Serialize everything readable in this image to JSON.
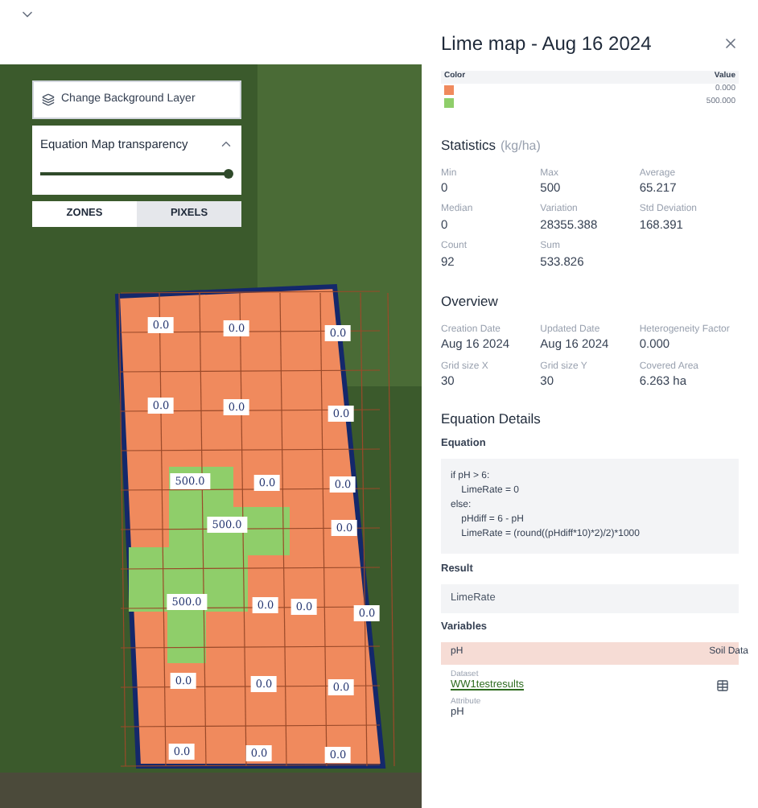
{
  "map": {
    "background_button": {
      "label": "Change Background Layer"
    },
    "transparency": {
      "label": "Equation Map transparency",
      "expanded": true,
      "level": 1
    },
    "view_tabs": [
      {
        "label": "ZONES",
        "selected": false
      },
      {
        "label": "PIXELS",
        "selected": true
      }
    ],
    "labels": [
      {
        "text": "0.0"
      },
      {
        "text": "0.0"
      },
      {
        "text": "0.0"
      },
      {
        "text": "0.0"
      },
      {
        "text": "0.0"
      },
      {
        "text": "0.0"
      },
      {
        "text": "500.0"
      },
      {
        "text": "0.0"
      },
      {
        "text": "0.0"
      },
      {
        "text": "500.0"
      },
      {
        "text": "0.0"
      },
      {
        "text": "500.0"
      },
      {
        "text": "0.0"
      },
      {
        "text": "0.0"
      },
      {
        "text": "0.0"
      },
      {
        "text": "0.0"
      },
      {
        "text": "0.0"
      },
      {
        "text": "0.0"
      },
      {
        "text": "0.0"
      },
      {
        "text": "0.0"
      },
      {
        "text": "0.0"
      }
    ]
  },
  "panel": {
    "title": "Lime map - Aug 16 2024",
    "legend": {
      "columns": [
        "Color",
        "Value"
      ],
      "rows": [
        {
          "color": "#f08a5d",
          "value": "0.000"
        },
        {
          "color": "#8fce6a",
          "value": "500.000"
        }
      ]
    },
    "statistics": {
      "title": "Statistics",
      "unit": "(kg/ha)",
      "items": [
        {
          "label": "Min",
          "value": "0"
        },
        {
          "label": "Max",
          "value": "500"
        },
        {
          "label": "Average",
          "value": "65.217"
        },
        {
          "label": "Median",
          "value": "0"
        },
        {
          "label": "Variation",
          "value": "28355.388"
        },
        {
          "label": "Std Deviation",
          "value": "168.391"
        },
        {
          "label": "Count",
          "value": "92"
        },
        {
          "label": "Sum",
          "value": "533.826"
        }
      ]
    },
    "overview": {
      "title": "Overview",
      "items": [
        {
          "label": "Creation Date",
          "value": "Aug 16 2024"
        },
        {
          "label": "Updated Date",
          "value": "Aug 16 2024"
        },
        {
          "label": "Heterogeneity Factor",
          "value": "0.000"
        },
        {
          "label": "Grid size X",
          "value": "30"
        },
        {
          "label": "Grid size Y",
          "value": "30"
        },
        {
          "label": "Covered Area",
          "value": "6.263 ha"
        }
      ]
    },
    "equation_details": {
      "title": "Equation Details",
      "equation_label": "Equation",
      "equation_lines": [
        "if pH > 6:",
        "    LimeRate = 0",
        "else:",
        "    pHdiff = 6 - pH",
        "    LimeRate = (round((pHdiff*10)*2)/2)*1000"
      ],
      "result_label": "Result",
      "result": "LimeRate",
      "variables_label": "Variables",
      "variables": [
        {
          "name": "pH",
          "source": "Soil Data",
          "dataset_label": "Dataset",
          "dataset": "WW1testresults",
          "attribute_label": "Attribute",
          "attribute": "pH"
        }
      ]
    }
  }
}
